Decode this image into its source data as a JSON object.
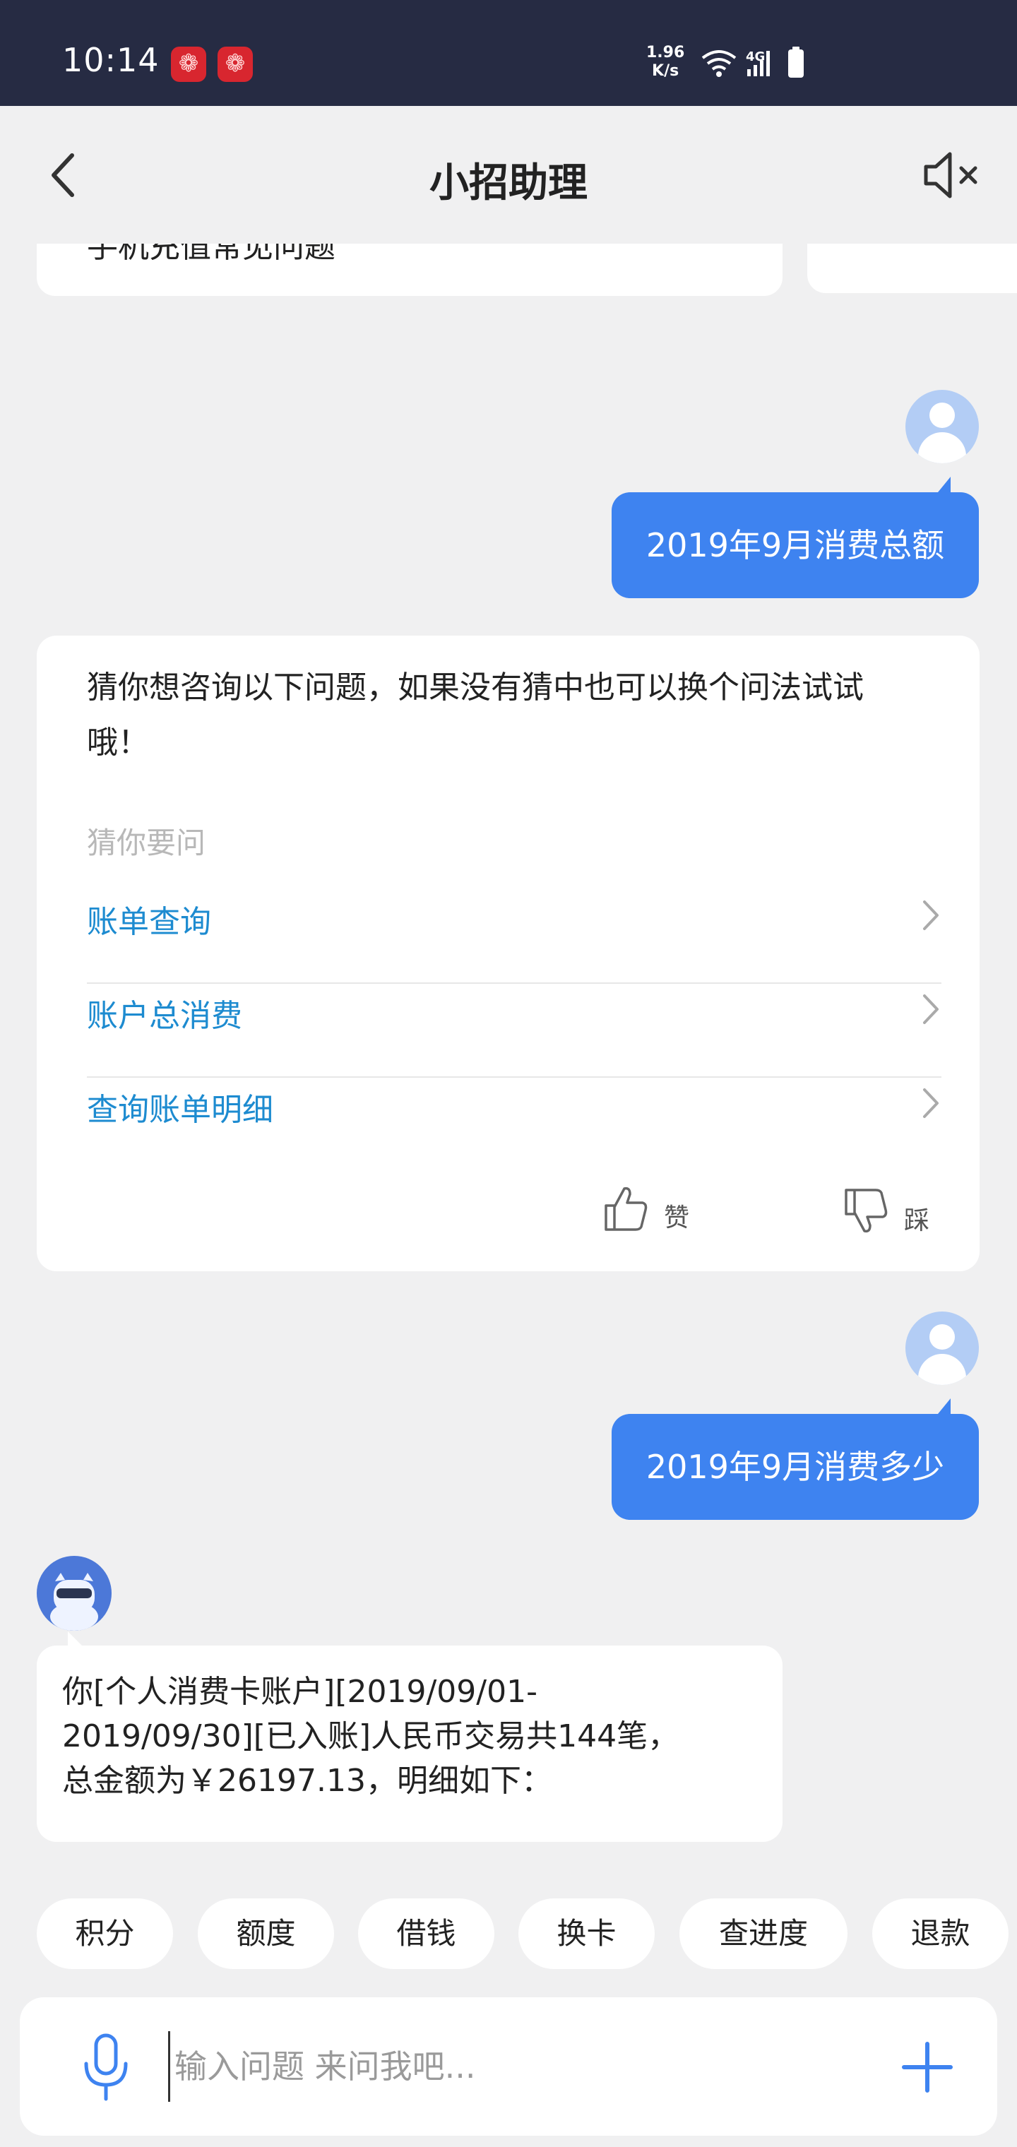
{
  "status_bar": {
    "time": "10:14",
    "speed_value": "1.96",
    "speed_unit": "K/s",
    "network": "4G",
    "icons": [
      "notification-icon",
      "notification-icon",
      "wifi-icon",
      "signal-icon",
      "battery-icon"
    ]
  },
  "header": {
    "title": "小招助理",
    "back_icon": "chevron-left-icon",
    "mute_icon": "speaker-muted-icon"
  },
  "chat": {
    "partial_card_text": "手机充值常见问题",
    "messages": [
      {
        "from": "user",
        "text": "2019年9月消费总额"
      },
      {
        "from": "bot_card",
        "intro": "猜你想咨询以下问题，如果没有猜中也可以换个问法试试哦！",
        "intro_line1": "猜你想咨询以下问题，如果没有猜中也可以换个问法试试",
        "intro_line2": "哦！",
        "guess_label": "猜你要问",
        "links": [
          "账单查询",
          "账户总消费",
          "查询账单明细"
        ],
        "like_label": "赞",
        "dislike_label": "踩"
      },
      {
        "from": "user",
        "text": "2019年9月消费多少"
      },
      {
        "from": "bot",
        "line1": "你[个人消费卡账户][2019/09/01-",
        "line2": "2019/09/30][已入账]人民币交易共144笔，",
        "line3": "总金额为￥26197.13，明细如下："
      }
    ]
  },
  "quick_chips": [
    "积分",
    "额度",
    "借钱",
    "换卡",
    "查进度",
    "退款"
  ],
  "input": {
    "placeholder": "输入问题 来问我吧...",
    "value": ""
  },
  "colors": {
    "status_bar_bg": "#262b43",
    "user_bubble": "#3e83f0",
    "link": "#1d8bd0",
    "accent": "#3e83f0",
    "page_bg": "#f0f0f1"
  }
}
